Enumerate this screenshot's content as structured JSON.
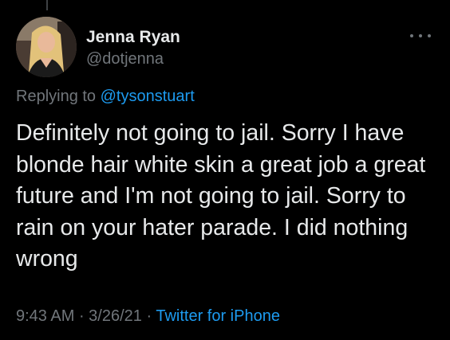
{
  "tweet": {
    "author": {
      "display_name": "Jenna Ryan",
      "handle": "@dotjenna"
    },
    "reply_prefix": "Replying to ",
    "reply_to": "@tysonstuart",
    "text": "Definitely not going to jail. Sorry I have blonde hair white skin a great job a great future and I'm not going to jail. Sorry to rain on your hater parade. I did nothing wrong",
    "time": "9:43 AM",
    "separator": " · ",
    "date": "3/26/21",
    "source": "Twitter for iPhone"
  },
  "icons": {
    "more": "more-horizontal-icon"
  },
  "colors": {
    "background": "#000000",
    "primary_text": "#e7e9ea",
    "secondary_text": "#71767b",
    "link": "#1d9bf0"
  }
}
